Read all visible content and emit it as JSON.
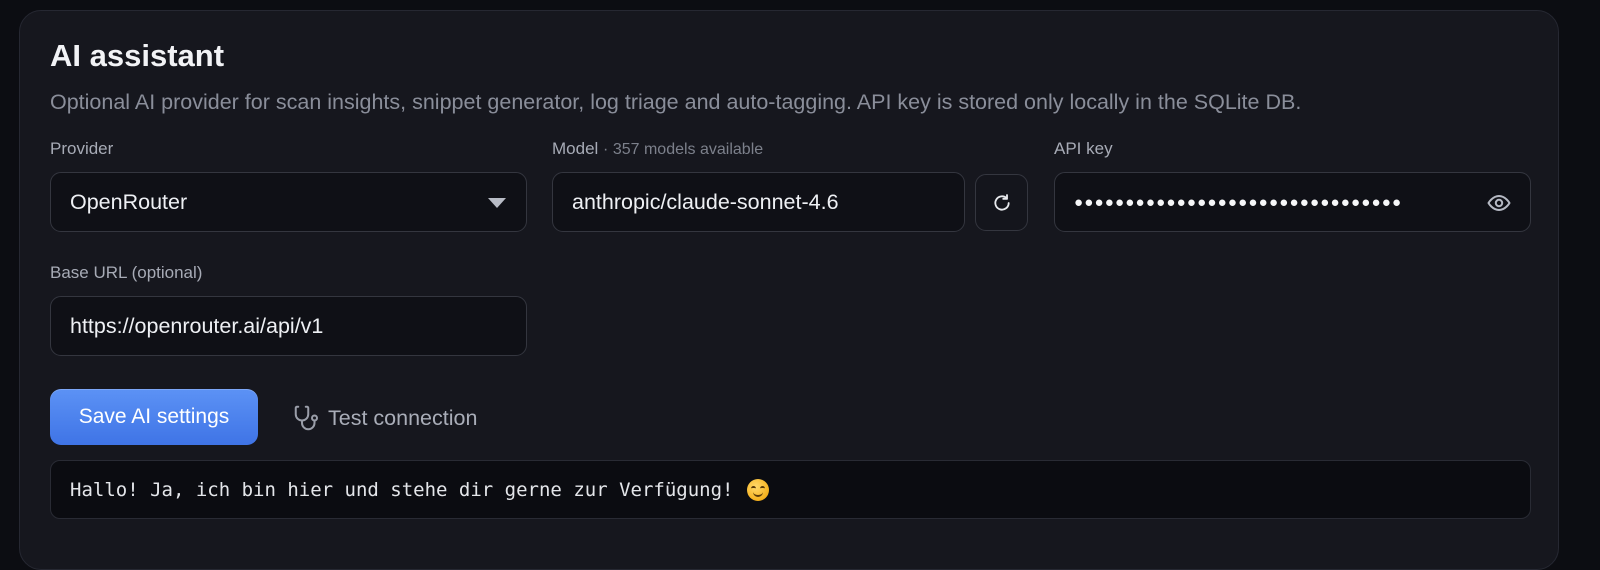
{
  "section": {
    "title": "AI assistant",
    "description": "Optional AI provider for scan insights, snippet generator, log triage and auto-tagging. API key is stored only locally in the SQLite DB."
  },
  "provider": {
    "label": "Provider",
    "value": "OpenRouter",
    "icon": "chevron-down-icon"
  },
  "model": {
    "label": "Model",
    "count_note": "· 357 models available",
    "value": "anthropic/claude-sonnet-4.6",
    "refresh_icon": "refresh-icon"
  },
  "api_key": {
    "label": "API key",
    "masked_value": "●●●●●●●●●●●●●●●●●●●●●●●●●●●●●●●●",
    "toggle_icon": "eye-icon"
  },
  "base_url": {
    "label": "Base URL (optional)",
    "value": "https://openrouter.ai/api/v1"
  },
  "actions": {
    "save_label": "Save AI settings",
    "test_label": "Test connection",
    "test_icon": "stethoscope-icon"
  },
  "output": {
    "text": "Hallo! Ja, ich bin hier und stehe dir gerne zur Verfügung!",
    "emoji": "smiling-face-emoji"
  },
  "colors": {
    "accent": "#4a80ee",
    "background": "#0c0d12",
    "card": "#16171e"
  }
}
